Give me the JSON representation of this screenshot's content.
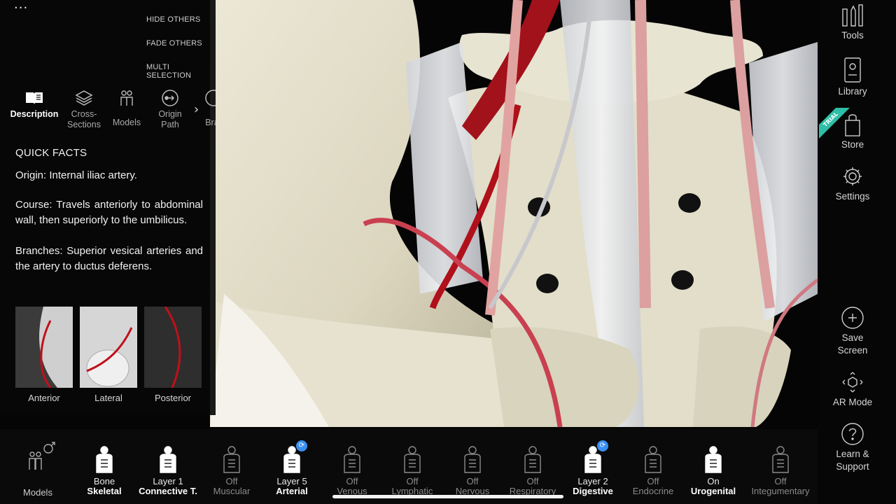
{
  "view_options": {
    "more": "...",
    "hide_others": "HIDE OTHERS",
    "fade_others": "FADE OTHERS",
    "multi_selection": "MULTI SELECTION"
  },
  "tabs": [
    {
      "label": "Description",
      "icon": "book-icon",
      "active": true
    },
    {
      "label": "Cross-\nSections",
      "icon": "layers-icon",
      "active": false
    },
    {
      "label": "Models",
      "icon": "people-icon",
      "active": false
    },
    {
      "label": "Origin\nPath",
      "icon": "path-icon",
      "active": false
    },
    {
      "label": "Brar",
      "icon": "branch-icon",
      "active": false
    }
  ],
  "info": {
    "heading": "QUICK FACTS",
    "origin": "Origin: Internal iliac artery.",
    "course": "Course: Travels anteriorly to abdominal wall, then superiorly to the umbilicus.",
    "branches": "Branches: Superior vesical arteries and the artery to ductus deferens."
  },
  "thumbnails": [
    "Anterior",
    "Lateral",
    "Posterior"
  ],
  "right_toolbar": {
    "tools": "Tools",
    "library": "Library",
    "trial": "TRIAL",
    "store": "Store",
    "settings": "Settings",
    "save_screen": "Save\nScreen",
    "ar_mode": "AR Mode",
    "learn_support": "Learn &\nSupport"
  },
  "bottom_bar": {
    "models_label": "Models",
    "systems": [
      {
        "state": "Bone",
        "name": "Skeletal",
        "on": true,
        "badge": false
      },
      {
        "state": "Layer 1",
        "name": "Connective T.",
        "on": true,
        "badge": false
      },
      {
        "state": "Off",
        "name": "Muscular",
        "on": false,
        "badge": false
      },
      {
        "state": "Layer 5",
        "name": "Arterial",
        "on": true,
        "badge": true
      },
      {
        "state": "Off",
        "name": "Venous",
        "on": false,
        "badge": false
      },
      {
        "state": "Off",
        "name": "Lymphatic",
        "on": false,
        "badge": false
      },
      {
        "state": "Off",
        "name": "Nervous",
        "on": false,
        "badge": false
      },
      {
        "state": "Off",
        "name": "Respiratory",
        "on": false,
        "badge": false
      },
      {
        "state": "Layer 2",
        "name": "Digestive",
        "on": true,
        "badge": true
      },
      {
        "state": "Off",
        "name": "Endocrine",
        "on": false,
        "badge": false
      },
      {
        "state": "On",
        "name": "Urogenital",
        "on": true,
        "badge": false
      },
      {
        "state": "Off",
        "name": "Integumentary",
        "on": false,
        "badge": false
      }
    ]
  },
  "colors": {
    "accent": "#2fbfa6",
    "badge": "#3a8ff0",
    "artery": "#b0101a",
    "bone": "#e4e0cc"
  }
}
